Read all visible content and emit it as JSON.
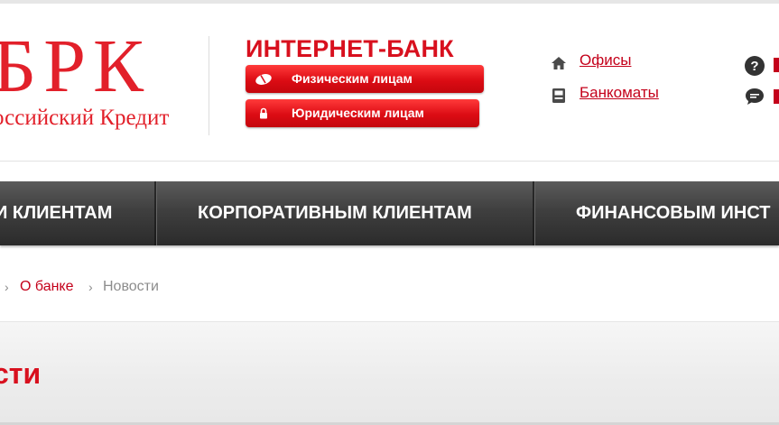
{
  "header": {
    "logo_letters": "БРК",
    "logo_subtitle": "оссийский Кредит",
    "internet_bank": {
      "title": "ИНТЕРНЕТ-БАНК",
      "individuals_label": "Физическим лицам",
      "legal_label": "Юридическим лицам"
    },
    "links": {
      "offices": "Офисы",
      "atms": "Банкоматы"
    }
  },
  "menu": {
    "items": [
      {
        "label": "и клиентам"
      },
      {
        "label": "Корпоративным клиентам"
      },
      {
        "label": "Финансовым инст"
      }
    ]
  },
  "breadcrumb": {
    "about": "О банке",
    "current": "Новости"
  },
  "page": {
    "title": "сти"
  },
  "colors": {
    "brand_red": "#d8101e",
    "menu_dark": "#3f3f3f",
    "link_red": "#c4001a"
  }
}
